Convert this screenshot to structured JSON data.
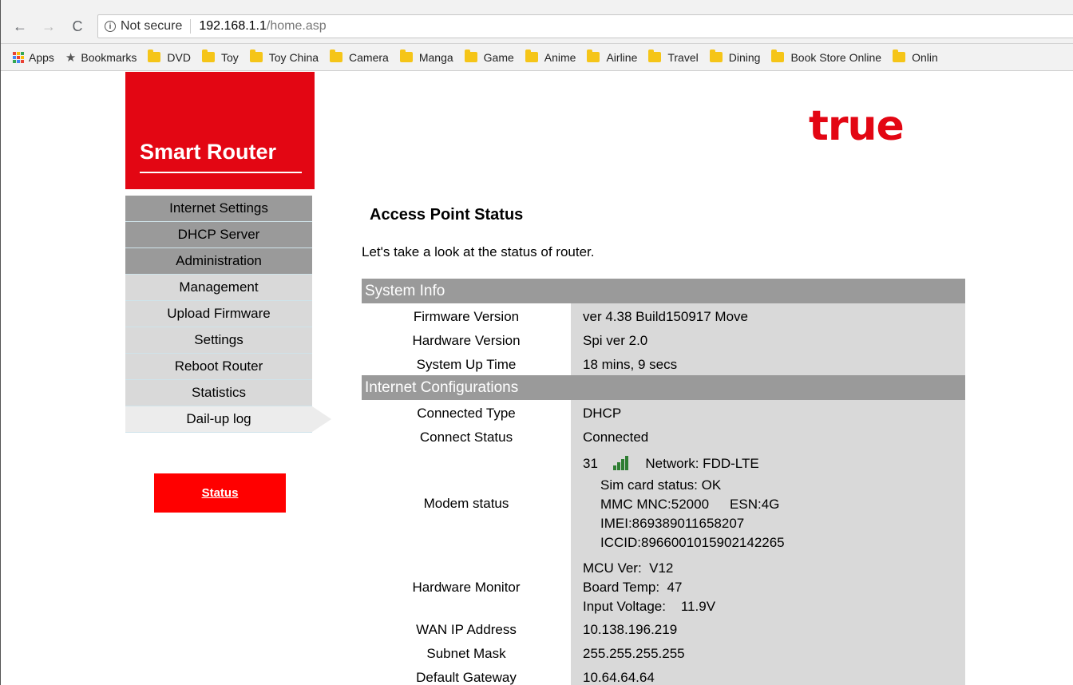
{
  "browser": {
    "nav": {
      "back": "←",
      "forward": "→",
      "reload": "C"
    },
    "omnibox": {
      "security": "Not secure",
      "host": "192.168.1.1",
      "path": "/home.asp"
    },
    "bookmarks": {
      "apps_label": "Apps",
      "bookmarks_label": "Bookmarks",
      "folders": [
        "DVD",
        "Toy",
        "Toy China",
        "Camera",
        "Manga",
        "Game",
        "Anime",
        "Airline",
        "Travel",
        "Dining",
        "Book Store Online",
        "Onlin"
      ]
    }
  },
  "page": {
    "brand": "Smart Router",
    "logo": "true",
    "menu": [
      {
        "label": "Internet Settings",
        "style": "dark"
      },
      {
        "label": "DHCP Server",
        "style": "dark"
      },
      {
        "label": "Administration",
        "style": "dark"
      },
      {
        "label": "Management",
        "style": "light"
      },
      {
        "label": "Upload Firmware",
        "style": "light"
      },
      {
        "label": "Settings",
        "style": "light"
      },
      {
        "label": "Reboot Router",
        "style": "light"
      },
      {
        "label": "Statistics",
        "style": "light"
      },
      {
        "label": "Dail-up log",
        "style": "active"
      }
    ],
    "status_button": "Status",
    "heading": "Access Point Status",
    "intro": "Let's take a look at the status of router.",
    "system_info": {
      "title": "System Info",
      "firmware_label": "Firmware Version",
      "firmware_value": "ver 4.38 Build150917 Move",
      "hardware_label": "Hardware Version",
      "hardware_value": "Spi ver 2.0",
      "uptime_label": "System Up Time",
      "uptime_value": "18 mins, 9 secs"
    },
    "internet": {
      "title": "Internet Configurations",
      "type_label": "Connected Type",
      "type_value": "DHCP",
      "status_label": "Connect Status",
      "status_value": "Connected",
      "modem_label": "Modem status",
      "modem": {
        "signal": "31",
        "network": "Network: FDD-LTE",
        "sim": "Sim card status: OK",
        "mmc": "MMC MNC:52000",
        "esn": "ESN:4G",
        "imei": "IMEI:869389011658207",
        "iccid": "ICCID:8966001015902142265"
      },
      "hw_label": "Hardware Monitor",
      "hw": {
        "mcu": "MCU Ver:  V12",
        "temp": "Board Temp:  47",
        "voltage": "Input Voltage:    11.9V"
      },
      "wan_label": "WAN IP Address",
      "wan_value": "10.138.196.219",
      "mask_label": "Subnet Mask",
      "mask_value": "255.255.255.255",
      "gw_label": "Default Gateway",
      "gw_value": "10.64.64.64"
    }
  }
}
